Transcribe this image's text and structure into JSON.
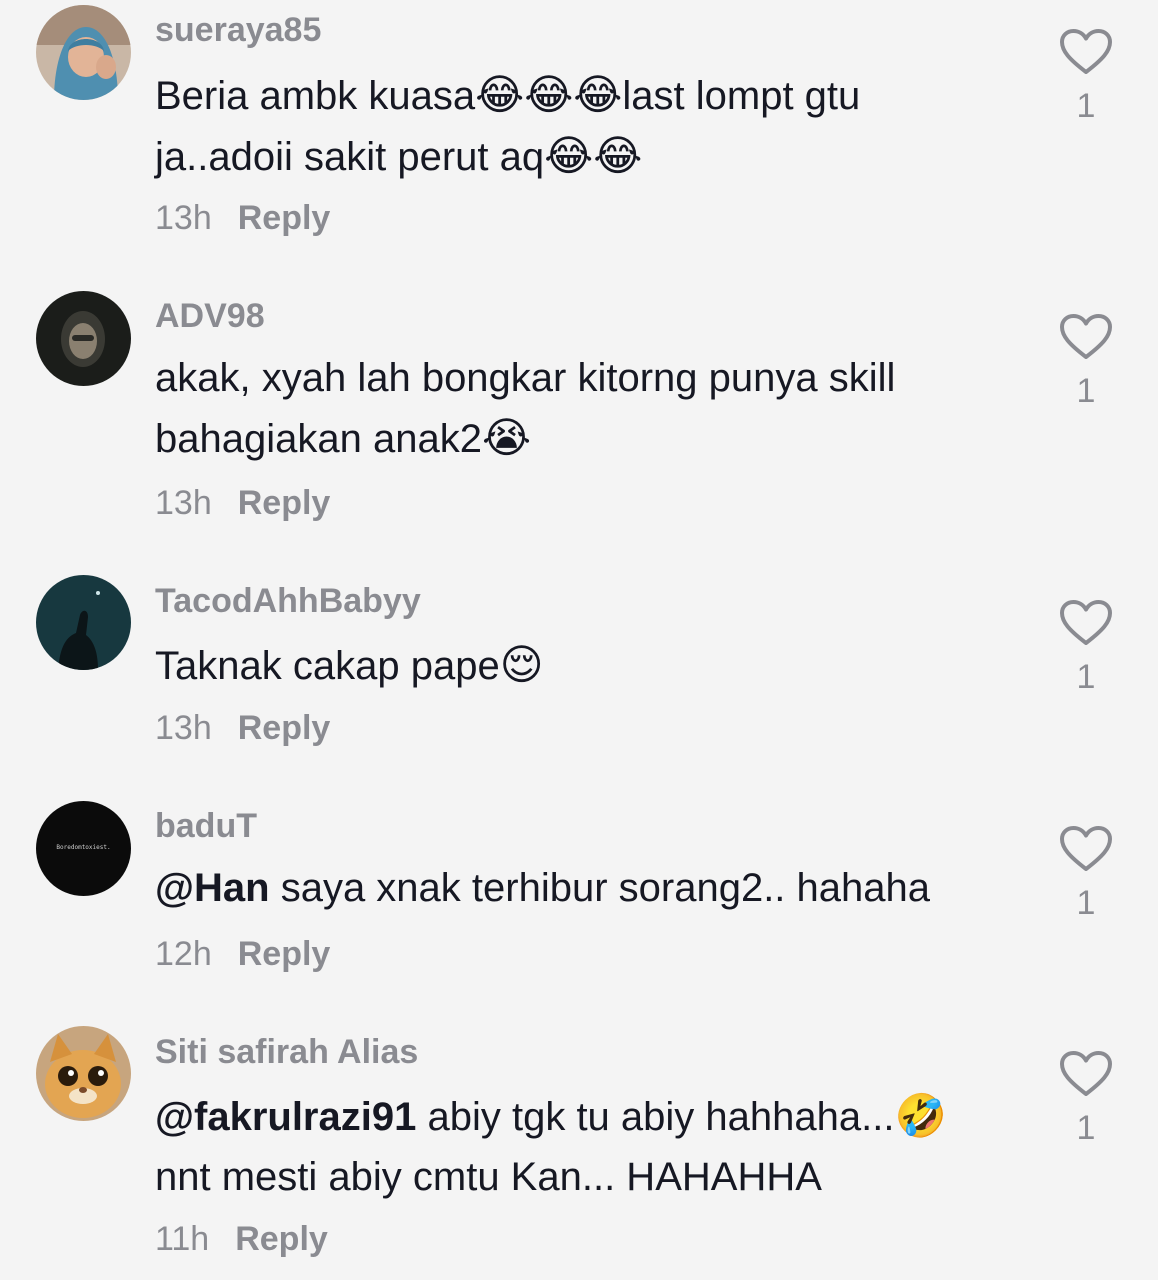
{
  "comments": [
    {
      "username": "sueraya85",
      "text_parts": [
        "Beria ambk kuasa",
        "😂😂😂",
        "last lompt gtu",
        "ja..adoii sakit perut aq",
        "😂😂"
      ],
      "time": "13h",
      "reply_label": "Reply",
      "likes": "1",
      "avatar_icon": "avatar-hijab-woman"
    },
    {
      "username": "ADV98",
      "text_parts": [
        "akak, xyah lah bongkar kitorng punya skill",
        "bahagiakan anak2",
        "😭"
      ],
      "time": "13h",
      "reply_label": "Reply",
      "likes": "1",
      "avatar_icon": "avatar-dark-portrait"
    },
    {
      "username": "TacodAhhBabyy",
      "text_parts": [
        "Taknak cakap pape",
        "😌"
      ],
      "time": "13h",
      "reply_label": "Reply",
      "likes": "1",
      "avatar_icon": "avatar-night-silhouette"
    },
    {
      "username": "baduT",
      "text_parts": [
        "@Han",
        " saya xnak terhibur sorang2.. hahaha"
      ],
      "avatar_text": "Boredomtoxiest.",
      "time": "12h",
      "reply_label": "Reply",
      "likes": "1",
      "avatar_icon": "avatar-black-text"
    },
    {
      "username": "Siti safirah Alias",
      "text_parts": [
        "@fakrulrazi91",
        " abiy tgk tu abiy hahhaha...",
        "🤣",
        "nnt mesti abiy cmtu Kan... HAHAHHA"
      ],
      "time": "11h",
      "reply_label": "Reply",
      "likes": "1",
      "avatar_icon": "avatar-cat"
    }
  ],
  "colors": {
    "background": "#f4f4f4",
    "text": "#161823",
    "muted": "#8a8b91"
  }
}
